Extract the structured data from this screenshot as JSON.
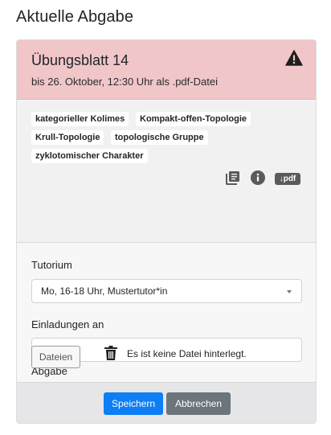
{
  "page": {
    "title": "Aktuelle Abgabe"
  },
  "card": {
    "header": {
      "title": "Übungsblatt 14",
      "deadline": "bis 26. Oktober, 12:30 Uhr als .pdf-Datei",
      "icon": "warning-icon",
      "color": "#f0c6c9"
    },
    "tags": [
      "kategorieller Kolimes",
      "Kompakt-offen-Topologie",
      "Krull-Topologie",
      "topologische Gruppe",
      "zyklotomischer Charakter"
    ],
    "actions": {
      "icons": [
        "library-icon",
        "info-icon"
      ],
      "pdf_badge": "↓pdf"
    }
  },
  "form": {
    "tutorium_label": "Tutorium",
    "tutorium_selected": "Mo, 16-18 Uhr, Mustertutor*in",
    "invitations_label": "Einladungen an",
    "invitations_value": "",
    "submission_label": "Abgabe",
    "files_button": "Dateien",
    "no_file_text": "Es ist keine Datei hinterlegt."
  },
  "footer": {
    "save_label": "Speichern",
    "cancel_label": "Abbrechen",
    "primary_color": "#0d7ef5",
    "secondary_color": "#6c747c"
  }
}
